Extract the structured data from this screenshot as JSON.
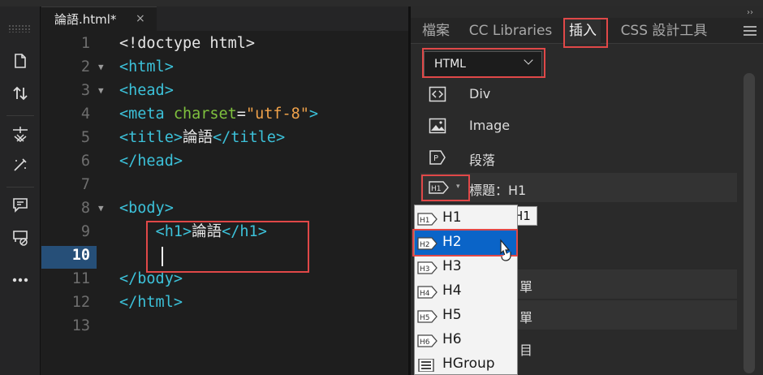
{
  "editor": {
    "tab_label": "論語.html*",
    "tab_close": "×",
    "lines": [
      {
        "n": "1",
        "fold": "",
        "tokens": [
          {
            "c": "t-plain",
            "t": "<!doctype html>"
          }
        ]
      },
      {
        "n": "2",
        "fold": "▼",
        "tokens": [
          {
            "c": "t-tag",
            "t": "<html>"
          }
        ]
      },
      {
        "n": "3",
        "fold": "▼",
        "tokens": [
          {
            "c": "t-tag",
            "t": "<head>"
          }
        ]
      },
      {
        "n": "4",
        "fold": "",
        "tokens": [
          {
            "c": "t-tag",
            "t": "<meta "
          },
          {
            "c": "t-attr",
            "t": "charset"
          },
          {
            "c": "t-plain",
            "t": "="
          },
          {
            "c": "t-str",
            "t": "\"utf-8\""
          },
          {
            "c": "t-tag",
            "t": ">"
          }
        ]
      },
      {
        "n": "5",
        "fold": "",
        "tokens": [
          {
            "c": "t-tag",
            "t": "<title>"
          },
          {
            "c": "t-plain",
            "t": "論語"
          },
          {
            "c": "t-tag",
            "t": "</title>"
          }
        ]
      },
      {
        "n": "6",
        "fold": "",
        "tokens": [
          {
            "c": "t-tag",
            "t": "</head>"
          }
        ]
      },
      {
        "n": "7",
        "fold": "",
        "tokens": []
      },
      {
        "n": "8",
        "fold": "▼",
        "tokens": [
          {
            "c": "t-tag",
            "t": "<body>"
          }
        ]
      },
      {
        "n": "9",
        "fold": "",
        "tokens": [
          {
            "c": "t-plain",
            "t": "    "
          },
          {
            "c": "t-tag",
            "t": "<h1>"
          },
          {
            "c": "t-plain",
            "t": "論語"
          },
          {
            "c": "t-tag",
            "t": "</h1>"
          }
        ]
      },
      {
        "n": "10",
        "fold": "",
        "tokens": []
      },
      {
        "n": "11",
        "fold": "",
        "tokens": [
          {
            "c": "t-tag",
            "t": "</body>"
          }
        ]
      },
      {
        "n": "12",
        "fold": "",
        "tokens": [
          {
            "c": "t-tag",
            "t": "</html>"
          }
        ]
      },
      {
        "n": "13",
        "fold": "",
        "tokens": []
      }
    ],
    "current_line": "10"
  },
  "panel": {
    "expand_glyph": "››",
    "tabs": [
      {
        "label": "檔案",
        "active": false
      },
      {
        "label": "CC Libraries",
        "active": false
      },
      {
        "label": "插入",
        "active": true
      },
      {
        "label": "CSS 設計工具",
        "active": false
      }
    ],
    "category_select": "HTML",
    "items": [
      {
        "label": "Div",
        "icon": "div-icon"
      },
      {
        "label": "Image",
        "icon": "image-icon"
      },
      {
        "label": "段落",
        "icon": "paragraph-icon"
      },
      {
        "label": "標題：H1",
        "icon": "heading-icon"
      }
    ],
    "partial_items": [
      "H1",
      "",
      "",
      "單",
      "單",
      "目"
    ],
    "tooltip": "H1"
  },
  "heading_menu": {
    "items": [
      {
        "label": "H1",
        "badge": "H1"
      },
      {
        "label": "H2",
        "badge": "H2"
      },
      {
        "label": "H3",
        "badge": "H3"
      },
      {
        "label": "H4",
        "badge": "H4"
      },
      {
        "label": "H5",
        "badge": "H5"
      },
      {
        "label": "H6",
        "badge": "H6"
      },
      {
        "label": "HGroup",
        "badge": ""
      }
    ],
    "selected": "H2"
  },
  "colors": {
    "highlight_box": "#e04848",
    "menu_selection": "#0a64c8",
    "line_highlight": "#264f78"
  }
}
